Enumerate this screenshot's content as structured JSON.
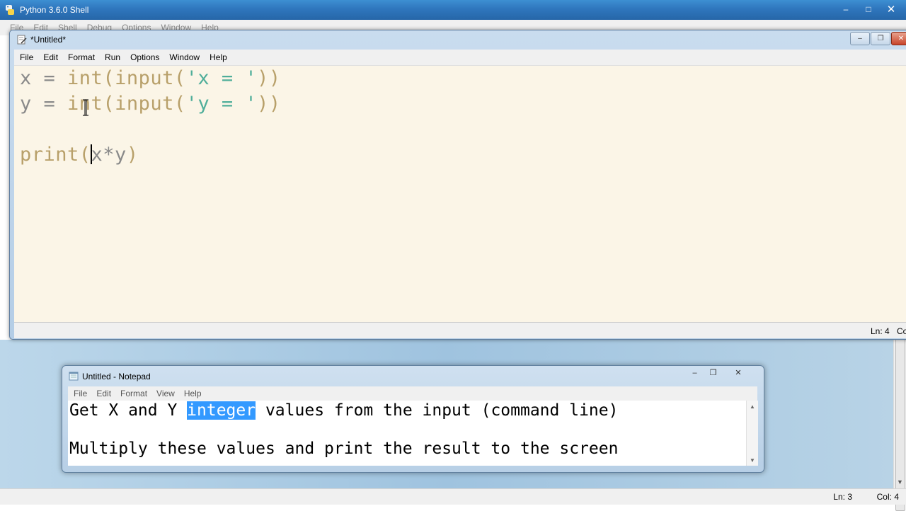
{
  "shell": {
    "title": "Python 3.6.0 Shell",
    "menu": [
      "File",
      "Edit",
      "Shell",
      "Debug",
      "Options",
      "Window",
      "Help"
    ],
    "status": {
      "ln": "Ln: 3",
      "col": "Col: 4"
    }
  },
  "editor": {
    "title": "*Untitled*",
    "menu": [
      "File",
      "Edit",
      "Format",
      "Run",
      "Options",
      "Window",
      "Help"
    ],
    "code": {
      "line1": {
        "var": "x",
        "op": " = ",
        "fn1": "int(input(",
        "str": "'x = '",
        "close": "))"
      },
      "line2": {
        "var": "y",
        "op": " = ",
        "fn1": "int(input(",
        "str": "'y = '",
        "close": "))"
      },
      "line4": {
        "fn": "print(",
        "expr": "x*y",
        "close": ")"
      }
    },
    "status": {
      "ln": "Ln: 4",
      "col": "Co"
    }
  },
  "notepad": {
    "title": "Untitled - Notepad",
    "menu": [
      "File",
      "Edit",
      "Format",
      "View",
      "Help"
    ],
    "line1_before": "Get X and Y ",
    "line1_selected": "integer",
    "line1_after": " values from the input (command line)",
    "line2": "Multiply these values and print the result to the screen"
  },
  "colors": {
    "code_keyword": "#b8a06a",
    "code_string": "#4fae9a",
    "code_background": "#fbf5e7",
    "selection": "#3399ff",
    "titlebar_active": "#2f76bd"
  },
  "icons": [
    "python-icon",
    "editor-icon",
    "notepad-icon",
    "minimize-icon",
    "maximize-icon",
    "close-icon",
    "text-cursor-icon"
  ]
}
